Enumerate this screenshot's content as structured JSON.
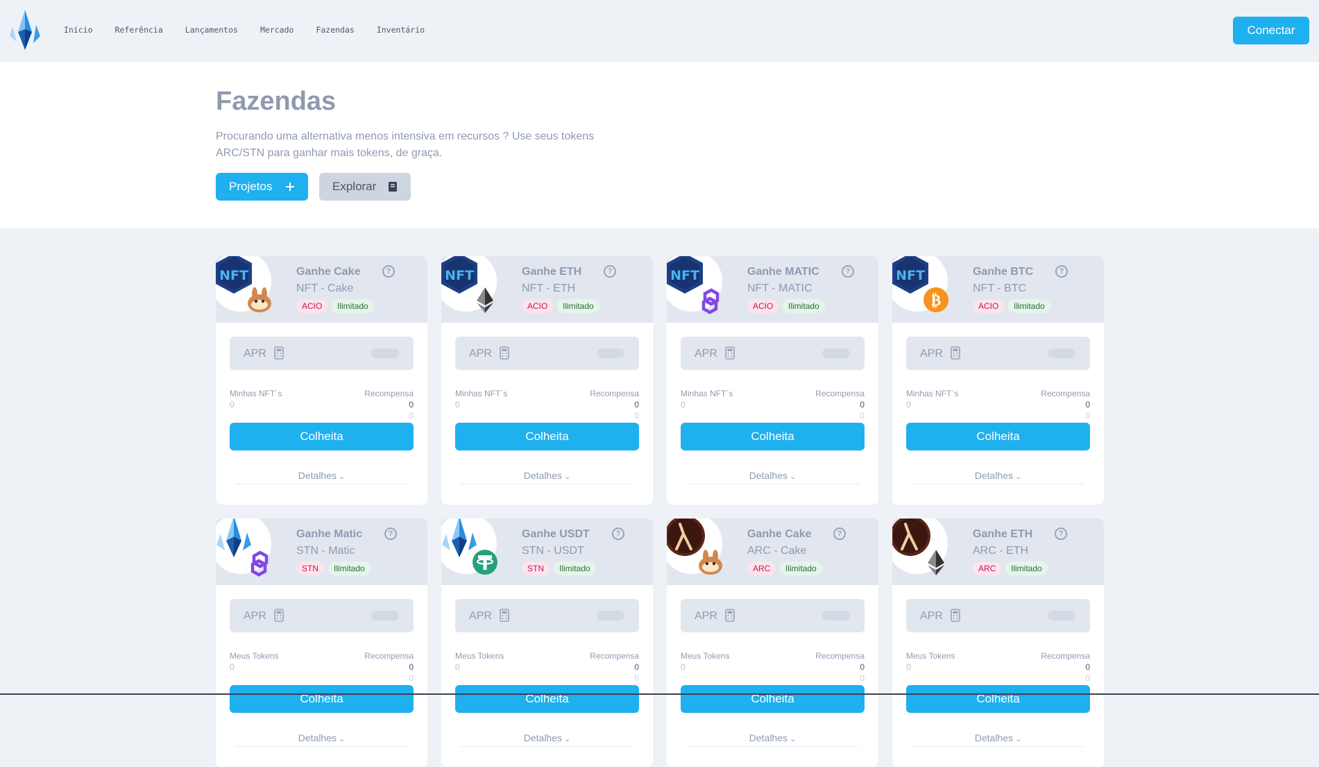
{
  "nav": {
    "links": [
      "Início",
      "Referência",
      "Lançamentos",
      "Mercado",
      "Fazendas",
      "Inventário"
    ],
    "connect_label": "Conectar"
  },
  "hero": {
    "title": "Fazendas",
    "description": "Procurando uma alternativa menos intensiva em recursos ? Use seus tokens ARC/STN para ganhar mais tokens, de graça.",
    "projects_label": "Projetos",
    "explore_label": "Explorar"
  },
  "colors": {
    "accent": "#1fb0ef",
    "badge_pink_bg": "#fce4ec",
    "badge_green_bg": "#e6f5ea"
  },
  "cards": [
    {
      "title": "Ganhe Cake",
      "subtitle": "NFT - Cake",
      "badge": "ACIO",
      "badge2": "Ilimitado",
      "main_icon": "nft-icon",
      "sub_icon": "pancake-icon",
      "apr_label": "APR",
      "stake_label": "Minhas NFT´s",
      "reward_label": "Recompensa",
      "stake_value": "0",
      "reward_value": "0",
      "reward_value2": "0",
      "harvest_label": "Colheita",
      "details_label": "Detalhes"
    },
    {
      "title": "Ganhe ETH",
      "subtitle": "NFT - ETH",
      "badge": "ACIO",
      "badge2": "Ilimitado",
      "main_icon": "nft-icon",
      "sub_icon": "ethereum-icon",
      "apr_label": "APR",
      "stake_label": "Minhas NFT´s",
      "reward_label": "Recompensa",
      "stake_value": "0",
      "reward_value": "0",
      "reward_value2": "0",
      "harvest_label": "Colheita",
      "details_label": "Detalhes"
    },
    {
      "title": "Ganhe MATIC",
      "subtitle": "NFT - MATIC",
      "badge": "ACIO",
      "badge2": "Ilimitado",
      "main_icon": "nft-icon",
      "sub_icon": "polygon-icon",
      "apr_label": "APR",
      "stake_label": "Minhas NFT´s",
      "reward_label": "Recompensa",
      "stake_value": "0",
      "reward_value": "0",
      "reward_value2": "0",
      "harvest_label": "Colheita",
      "details_label": "Detalhes"
    },
    {
      "title": "Ganhe BTC",
      "subtitle": "NFT - BTC",
      "badge": "ACIO",
      "badge2": "Ilimitado",
      "main_icon": "nft-icon",
      "sub_icon": "bitcoin-icon",
      "apr_label": "APR",
      "stake_label": "Minhas NFT´s",
      "reward_label": "Recompensa",
      "stake_value": "0",
      "reward_value": "0",
      "reward_value2": "0",
      "harvest_label": "Colheita",
      "details_label": "Detalhes"
    },
    {
      "title": "Ganhe Matic",
      "subtitle": "STN - Matic",
      "badge": "STN",
      "badge2": "Ilimitado",
      "main_icon": "stn-crystal-icon",
      "sub_icon": "polygon-icon",
      "apr_label": "APR",
      "stake_label": "Meus Tokens",
      "reward_label": "Recompensa",
      "stake_value": "0",
      "reward_value": "0",
      "reward_value2": "0",
      "harvest_label": "Colheita",
      "details_label": "Detalhes"
    },
    {
      "title": "Ganhe USDT",
      "subtitle": "STN - USDT",
      "badge": "STN",
      "badge2": "Ilimitado",
      "main_icon": "stn-crystal-icon",
      "sub_icon": "tether-icon",
      "apr_label": "APR",
      "stake_label": "Meus Tokens",
      "reward_label": "Recompensa",
      "stake_value": "0",
      "reward_value": "0",
      "reward_value2": "0",
      "harvest_label": "Colheita",
      "details_label": "Detalhes"
    },
    {
      "title": "Ganhe Cake",
      "subtitle": "ARC - Cake",
      "badge": "ARC",
      "badge2": "Ilimitado",
      "main_icon": "arc-lambda-icon",
      "sub_icon": "pancake-icon",
      "apr_label": "APR",
      "stake_label": "Meus Tokens",
      "reward_label": "Recompensa",
      "stake_value": "0",
      "reward_value": "0",
      "reward_value2": "0",
      "harvest_label": "Colheita",
      "details_label": "Detalhes"
    },
    {
      "title": "Ganhe ETH",
      "subtitle": "ARC - ETH",
      "badge": "ARC",
      "badge2": "Ilimitado",
      "main_icon": "arc-lambda-icon",
      "sub_icon": "ethereum-icon",
      "apr_label": "APR",
      "stake_label": "Meus Tokens",
      "reward_label": "Recompensa",
      "stake_value": "0",
      "reward_value": "0",
      "reward_value2": "0",
      "harvest_label": "Colheita",
      "details_label": "Detalhes"
    }
  ]
}
